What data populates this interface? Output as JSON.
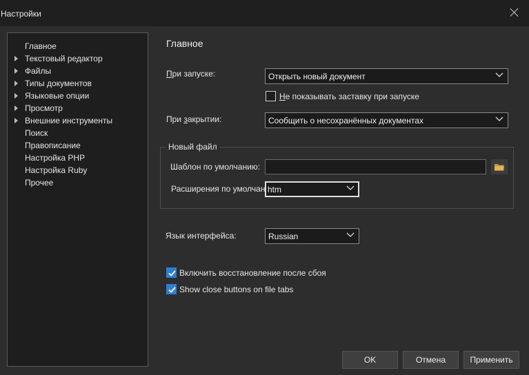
{
  "window": {
    "title": "Настройки",
    "close_icon": "close-icon"
  },
  "tree": {
    "items": [
      {
        "label": "Главное",
        "expandable": false
      },
      {
        "label": "Текстовый редактор",
        "expandable": true
      },
      {
        "label": "Файлы",
        "expandable": true
      },
      {
        "label": "Типы документов",
        "expandable": true
      },
      {
        "label": "Языковые опции",
        "expandable": true
      },
      {
        "label": "Просмотр",
        "expandable": true
      },
      {
        "label": "Внешние инструменты",
        "expandable": true
      },
      {
        "label": "Поиск",
        "expandable": false
      },
      {
        "label": "Правописание",
        "expandable": false
      },
      {
        "label": "Настройка PHP",
        "expandable": false
      },
      {
        "label": "Настройка Ruby",
        "expandable": false
      },
      {
        "label": "Прочее",
        "expandable": false
      }
    ]
  },
  "main": {
    "section_title": "Главное",
    "on_start": {
      "label_underlined": "П",
      "label_rest": "ри запуске:",
      "value": "Открыть новый документ"
    },
    "no_splash": {
      "label_underlined": "Н",
      "label_rest": "е показывать заставку при запуске",
      "checked": false
    },
    "on_close": {
      "label_start": "При ",
      "label_underlined": "з",
      "label_rest": "акрытии:",
      "value": "Сообщить о несохранённых документах"
    },
    "new_file": {
      "group_title": "Новый файл",
      "template_label": "Шаблон по умолчанию:",
      "template_value": "",
      "extension_label": "Расширения по умолчан",
      "extension_value": "htm"
    },
    "ui_language": {
      "label": "Язык интерфейса:",
      "value": "Russian"
    },
    "crash_recovery": {
      "label": "Включить восстановление после сбоя",
      "checked": true
    },
    "close_buttons": {
      "label": "Show close buttons on file tabs",
      "checked": true
    }
  },
  "buttons": {
    "ok": "OK",
    "cancel": "Отмена",
    "apply": "Применить"
  },
  "colors": {
    "accent": "#2f7fd1",
    "background": "#2d2d2d",
    "title_bar": "#1f1f1f"
  }
}
